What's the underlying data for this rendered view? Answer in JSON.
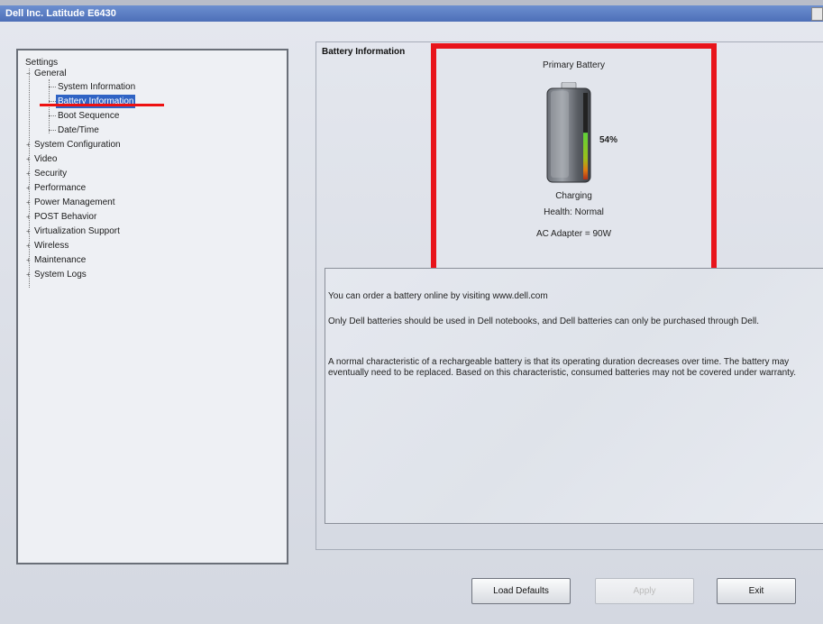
{
  "window": {
    "title": "Dell Inc. Latitude E6430"
  },
  "tree": {
    "root": "Settings",
    "general": "General",
    "general_children": [
      "System Information",
      "Battery Information",
      "Boot Sequence",
      "Date/Time"
    ],
    "collapsed": [
      "System Configuration",
      "Video",
      "Security",
      "Performance",
      "Power Management",
      "POST Behavior",
      "Virtualization Support",
      "Wireless",
      "Maintenance",
      "System Logs"
    ],
    "selected": "Battery Information"
  },
  "battery_info": {
    "group_title": "Battery Information",
    "battery_name": "Primary Battery",
    "charge_percent": "54%",
    "charge_level": 0.54,
    "status": "Charging",
    "health": "Health: Normal",
    "ac_adapter": "AC Adapter = 90W"
  },
  "description": {
    "line1": "You can order a battery online by visiting www.dell.com",
    "line2": "Only Dell batteries should be used in Dell notebooks, and Dell batteries can only be purchased through Dell.",
    "line3": "A normal characteristic of a rechargeable battery is that its operating duration decreases over time.  The battery may eventually need to be replaced.  Based on this characteristic, consumed batteries may not be covered under warranty."
  },
  "buttons": {
    "load_defaults": "Load Defaults",
    "apply": "Apply",
    "exit": "Exit"
  },
  "colors": {
    "highlight_box": "#e8141b",
    "selection": "#2f63c4",
    "titlebar": "#5a7cc4"
  }
}
